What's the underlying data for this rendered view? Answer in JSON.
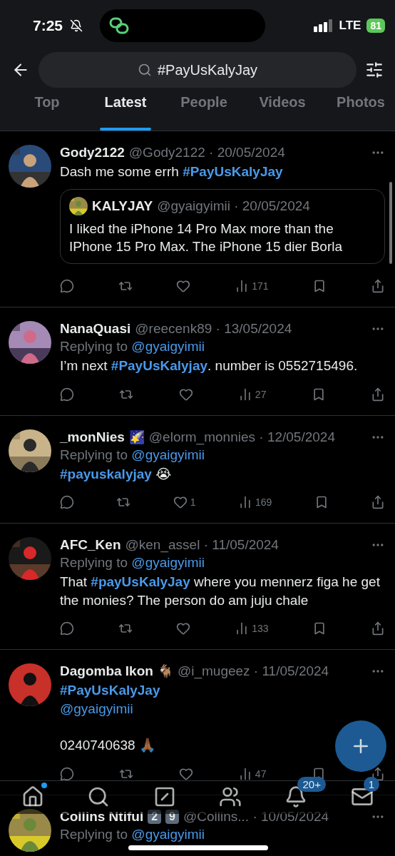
{
  "status_bar": {
    "time": "7:25",
    "network": "LTE",
    "battery": "81",
    "silent": true
  },
  "search": {
    "value": "#PayUsKalyJay"
  },
  "tabs": [
    {
      "label": "Top",
      "selected": false
    },
    {
      "label": "Latest",
      "selected": true
    },
    {
      "label": "People",
      "selected": false
    },
    {
      "label": "Videos",
      "selected": false
    },
    {
      "label": "Photos",
      "selected": false
    }
  ],
  "tweets": [
    {
      "name": "Gody2122",
      "meta": "@Gody2122 · 20/05/2024",
      "body": [
        {
          "kind": "text",
          "text": "Dash me some errh "
        },
        {
          "kind": "tag",
          "text": "#PayUsKalyJay"
        }
      ],
      "quote": {
        "name": "KALYJAY",
        "meta": "@gyaigyimii · 20/05/2024",
        "text": "I liked the iPhone 14 Pro Max more than the IPhone 15 Pro Max. The iPhone 15 dier Borla"
      },
      "views": "171"
    },
    {
      "name": "NanaQuasi",
      "meta": "@reecenk89 · 13/05/2024",
      "replying_label": "Replying to",
      "replying_to": "@gyaigyimii",
      "body": [
        {
          "kind": "text",
          "text": "I’m next "
        },
        {
          "kind": "tag",
          "text": "#PayUsKalyjay"
        },
        {
          "kind": "text",
          "text": ". number is 0552715496."
        }
      ],
      "views": "27"
    },
    {
      "name": "_monNies",
      "name_emoji": "🌠",
      "meta": "@elorm_monnies · 12/05/2024",
      "replying_label": "Replying to",
      "replying_to": "@gyaigyimii",
      "body": [
        {
          "kind": "tag",
          "text": "#payuskalyjay"
        },
        {
          "kind": "text",
          "text": " 😭"
        }
      ],
      "likes": "1",
      "views": "169"
    },
    {
      "name": "AFC_Ken",
      "meta": "@ken_assel · 11/05/2024",
      "replying_label": "Replying to",
      "replying_to": "@gyaigyimii",
      "body": [
        {
          "kind": "text",
          "text": "That "
        },
        {
          "kind": "tag",
          "text": "#payUsKalyJay"
        },
        {
          "kind": "text",
          "text": " where you mennerz figa he get the monies? The person do am juju chale"
        }
      ],
      "views": "133"
    },
    {
      "name": "Dagomba Ikon",
      "name_emoji": "🐐",
      "meta": "@i_mugeez · 11/05/2024",
      "body": [
        {
          "kind": "tag",
          "text": "#PayUsKalyJay"
        },
        {
          "kind": "break"
        },
        {
          "kind": "mention",
          "text": "@gyaigyimii"
        },
        {
          "kind": "break"
        },
        {
          "kind": "break"
        },
        {
          "kind": "text",
          "text": "0240740638 🙏🏾"
        }
      ],
      "views": "47"
    },
    {
      "name": "Collins Ntiful",
      "keycaps": [
        "2",
        "9"
      ],
      "meta": "@Collins... · 10/05/2024",
      "replying_label": "Replying to",
      "replying_to": "@gyaigyimii"
    }
  ],
  "nav": [
    {
      "kind": "home",
      "dot": true
    },
    {
      "kind": "search",
      "dot": false
    },
    {
      "kind": "grok",
      "dot": false
    },
    {
      "kind": "communities",
      "dot": false
    },
    {
      "kind": "notifications",
      "dot": false,
      "badge": "20+"
    },
    {
      "kind": "messages",
      "dot": false,
      "badge": "1"
    }
  ]
}
